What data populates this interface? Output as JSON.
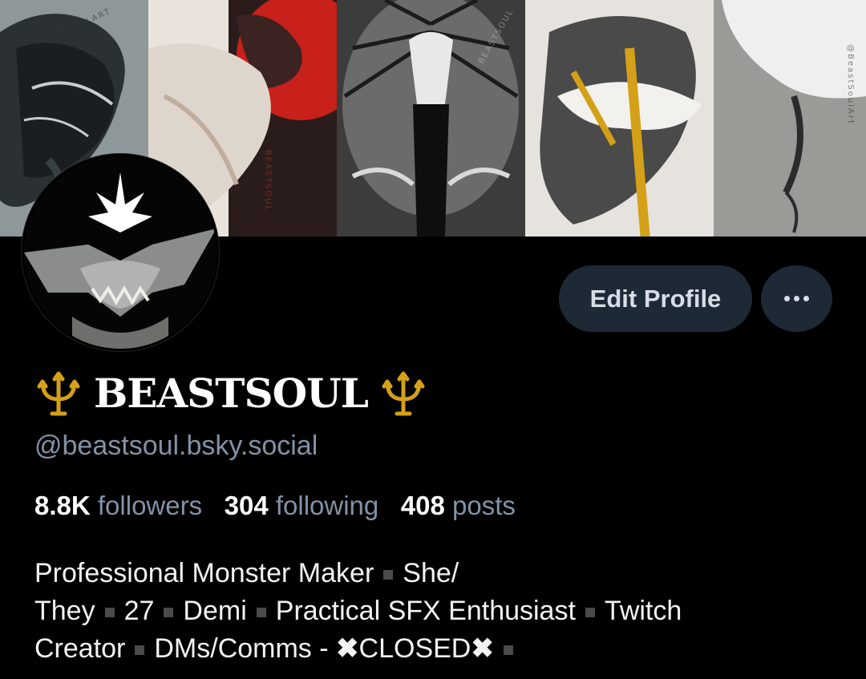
{
  "profile": {
    "display_name": "BEASTSOUL",
    "name_emoji": "trident-emblem",
    "handle": "@beastsoul.bsky.social",
    "edit_label": "Edit Profile",
    "more_label": "more-options"
  },
  "stats": {
    "followers_count": "8.8K",
    "followers_label": "followers",
    "following_count": "304",
    "following_label": "following",
    "posts_count": "408",
    "posts_label": "posts"
  },
  "bio": {
    "line1_a": "Professional Monster Maker",
    "line1_b": "She/",
    "line2_a": "They",
    "line2_b": "27",
    "line2_c": "Demi",
    "line2_d": "Practical SFX Enthusiast",
    "line2_e": "Twitch",
    "line3_a": "Creator",
    "line3_b": "DMs/Comms - ",
    "line3_x": "✖",
    "line3_c": "CLOSED"
  },
  "banner": {
    "watermarks": [
      "BEASTSOULART",
      "BEASTSOUL",
      "BEASTSOUL",
      "@BeastSoulArt"
    ]
  },
  "colors": {
    "background": "#000000",
    "button_bg": "#1e2936",
    "muted_text": "#8292a6",
    "accent_red": "#c8201a",
    "gold": "#d4a017"
  }
}
